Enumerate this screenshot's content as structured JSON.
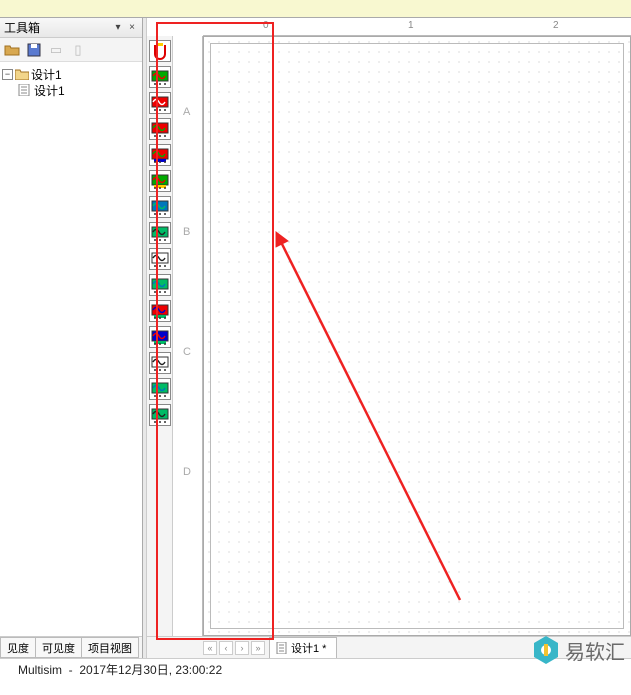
{
  "sidebar": {
    "title": "工具箱",
    "tree": {
      "root_label": "设计1",
      "child_label": "设计1"
    },
    "tabs": [
      "见度",
      "可见度",
      "项目视图"
    ]
  },
  "ruler_h": {
    "ticks": [
      {
        "pos": 60,
        "label": "0"
      },
      {
        "pos": 205,
        "label": "1"
      },
      {
        "pos": 350,
        "label": "2"
      }
    ]
  },
  "ruler_v": {
    "labels": [
      {
        "pos": 70,
        "label": "A"
      },
      {
        "pos": 190,
        "label": "B"
      },
      {
        "pos": 310,
        "label": "C"
      },
      {
        "pos": 430,
        "label": "D"
      }
    ]
  },
  "instruments": [
    {
      "name": "multimeter-icon",
      "colors": [
        "#fff",
        "#e00",
        "#fc0"
      ]
    },
    {
      "name": "function-gen-icon",
      "colors": [
        "#0a0",
        "#e00"
      ]
    },
    {
      "name": "wattmeter-icon",
      "colors": [
        "#e00",
        "#fff"
      ]
    },
    {
      "name": "oscilloscope-2ch-icon",
      "colors": [
        "#e00",
        "#0a0"
      ]
    },
    {
      "name": "oscilloscope-4ch-icon",
      "colors": [
        "#e00",
        "#0a0",
        "#00c"
      ]
    },
    {
      "name": "bode-plotter-icon",
      "colors": [
        "#0a0",
        "#e00",
        "#fc0"
      ]
    },
    {
      "name": "freq-counter-icon",
      "colors": [
        "#07b",
        "#0b6"
      ]
    },
    {
      "name": "word-gen-icon",
      "colors": [
        "#0b6",
        "#222"
      ]
    },
    {
      "name": "logic-analyzer-icon",
      "colors": [
        "#fff",
        "#222"
      ]
    },
    {
      "name": "logic-converter-icon",
      "colors": [
        "#0b6",
        "#07b"
      ]
    },
    {
      "name": "iv-analyzer-icon",
      "colors": [
        "#e00",
        "#00c",
        "#0b6"
      ]
    },
    {
      "name": "distortion-icon",
      "colors": [
        "#00c",
        "#e00",
        "#0b6"
      ]
    },
    {
      "name": "spectrum-icon",
      "colors": [
        "#fff",
        "#222"
      ]
    },
    {
      "name": "network-analyzer-icon",
      "colors": [
        "#0b6",
        "#07b"
      ]
    },
    {
      "name": "agilent-scope-icon",
      "colors": [
        "#0b6",
        "#222"
      ]
    }
  ],
  "tab": {
    "label": "设计1 *"
  },
  "statusbar": {
    "app": "Multisim",
    "sep": "-",
    "datetime": "2017年12月30日, 23:00:22"
  },
  "watermark": "易软汇"
}
